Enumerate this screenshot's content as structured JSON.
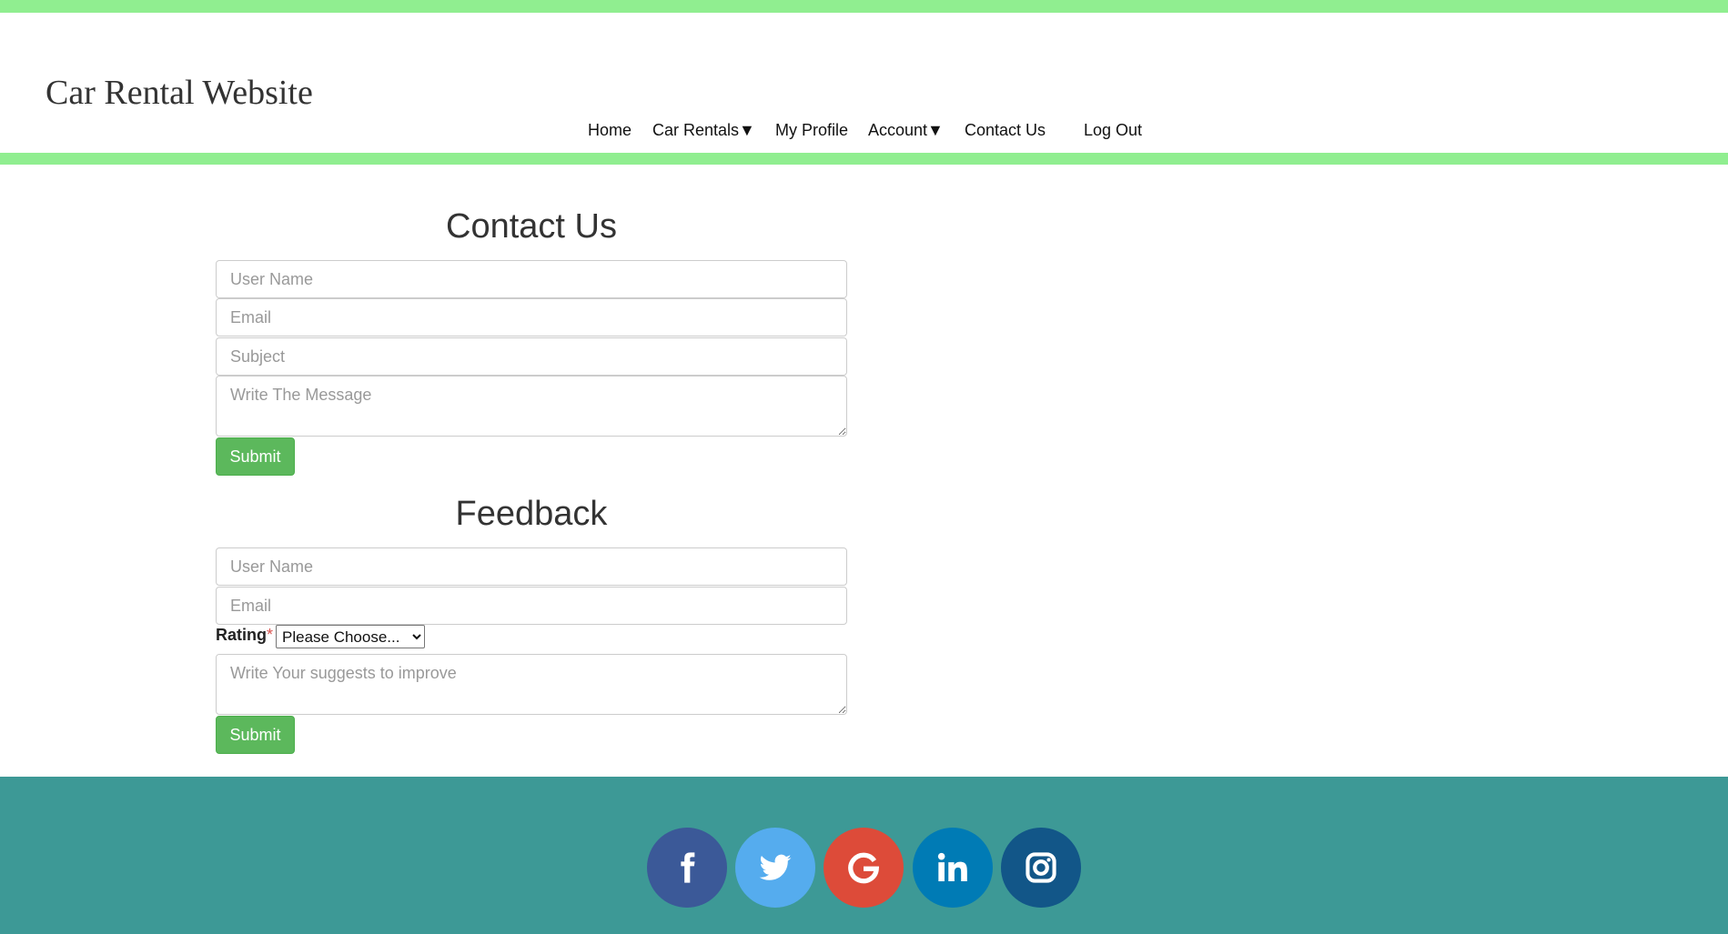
{
  "header": {
    "site_title": "Car Rental Website",
    "nav": [
      {
        "label": "Home"
      },
      {
        "label": "Car Rentals▼"
      },
      {
        "label": "My Profile"
      },
      {
        "label": "Account▼"
      },
      {
        "label": "Contact Us"
      },
      {
        "label": "Log Out"
      }
    ]
  },
  "contact": {
    "title": "Contact Us",
    "username_placeholder": "User Name",
    "email_placeholder": "Email",
    "subject_placeholder": "Subject",
    "message_placeholder": "Write The Message",
    "submit_label": "Submit"
  },
  "feedback": {
    "title": "Feedback",
    "username_placeholder": "User Name",
    "email_placeholder": "Email",
    "rating_label": "Rating",
    "required_mark": "*",
    "rating_selected": "Please Choose...",
    "suggestion_placeholder": "Write Your suggests to improve",
    "submit_label": "Submit"
  },
  "footer": {
    "social": [
      {
        "icon": "facebook-icon",
        "color": "#3b5998"
      },
      {
        "icon": "twitter-icon",
        "color": "#55acee"
      },
      {
        "icon": "google-icon",
        "color": "#dd4b39"
      },
      {
        "icon": "linkedin-icon",
        "color": "#007bb5"
      },
      {
        "icon": "instagram-icon",
        "color": "#125688"
      }
    ]
  },
  "colors": {
    "accent_stripe": "#90ee90",
    "submit_green": "#5cb85c",
    "footer_teal": "#3d9996"
  }
}
